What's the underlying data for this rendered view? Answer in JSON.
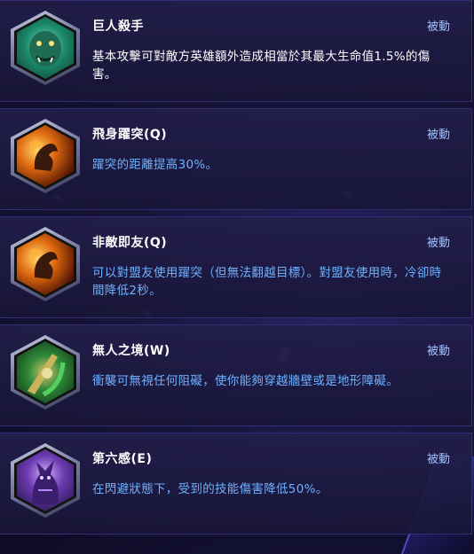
{
  "talents": [
    {
      "title": "巨人殺手",
      "type": "被動",
      "description": "基本攻擊可對敵方英雄額外造成相當於其最大生命值1.5%的傷害。",
      "icon": "ogre-face-icon"
    },
    {
      "title": "飛身躍突(Q)",
      "type": "被動",
      "description": "躍突的距離提高30%。",
      "icon": "leap-fire-icon"
    },
    {
      "title": "非敵即友(Q)",
      "type": "被動",
      "description": "可以對盟友使用躍突（但無法翻越目標）。對盟友使用時，冷卻時間降低2秒。",
      "icon": "leap-fire-icon"
    },
    {
      "title": "無人之境(W)",
      "type": "被動",
      "description": "衝襲可無視任何阻礙，使你能夠穿越牆壁或是地形障礙。",
      "icon": "blade-armor-icon"
    },
    {
      "title": "第六感(E)",
      "type": "被動",
      "description": "在閃避狀態下，受到的技能傷害降低50%。",
      "icon": "shadow-figure-icon"
    }
  ],
  "colors": {
    "title": "#ffffff",
    "description_first": "#ffffff",
    "description": "#6db2ff",
    "type_label": "#9ec2ff",
    "row_background": "#1e1a48"
  }
}
